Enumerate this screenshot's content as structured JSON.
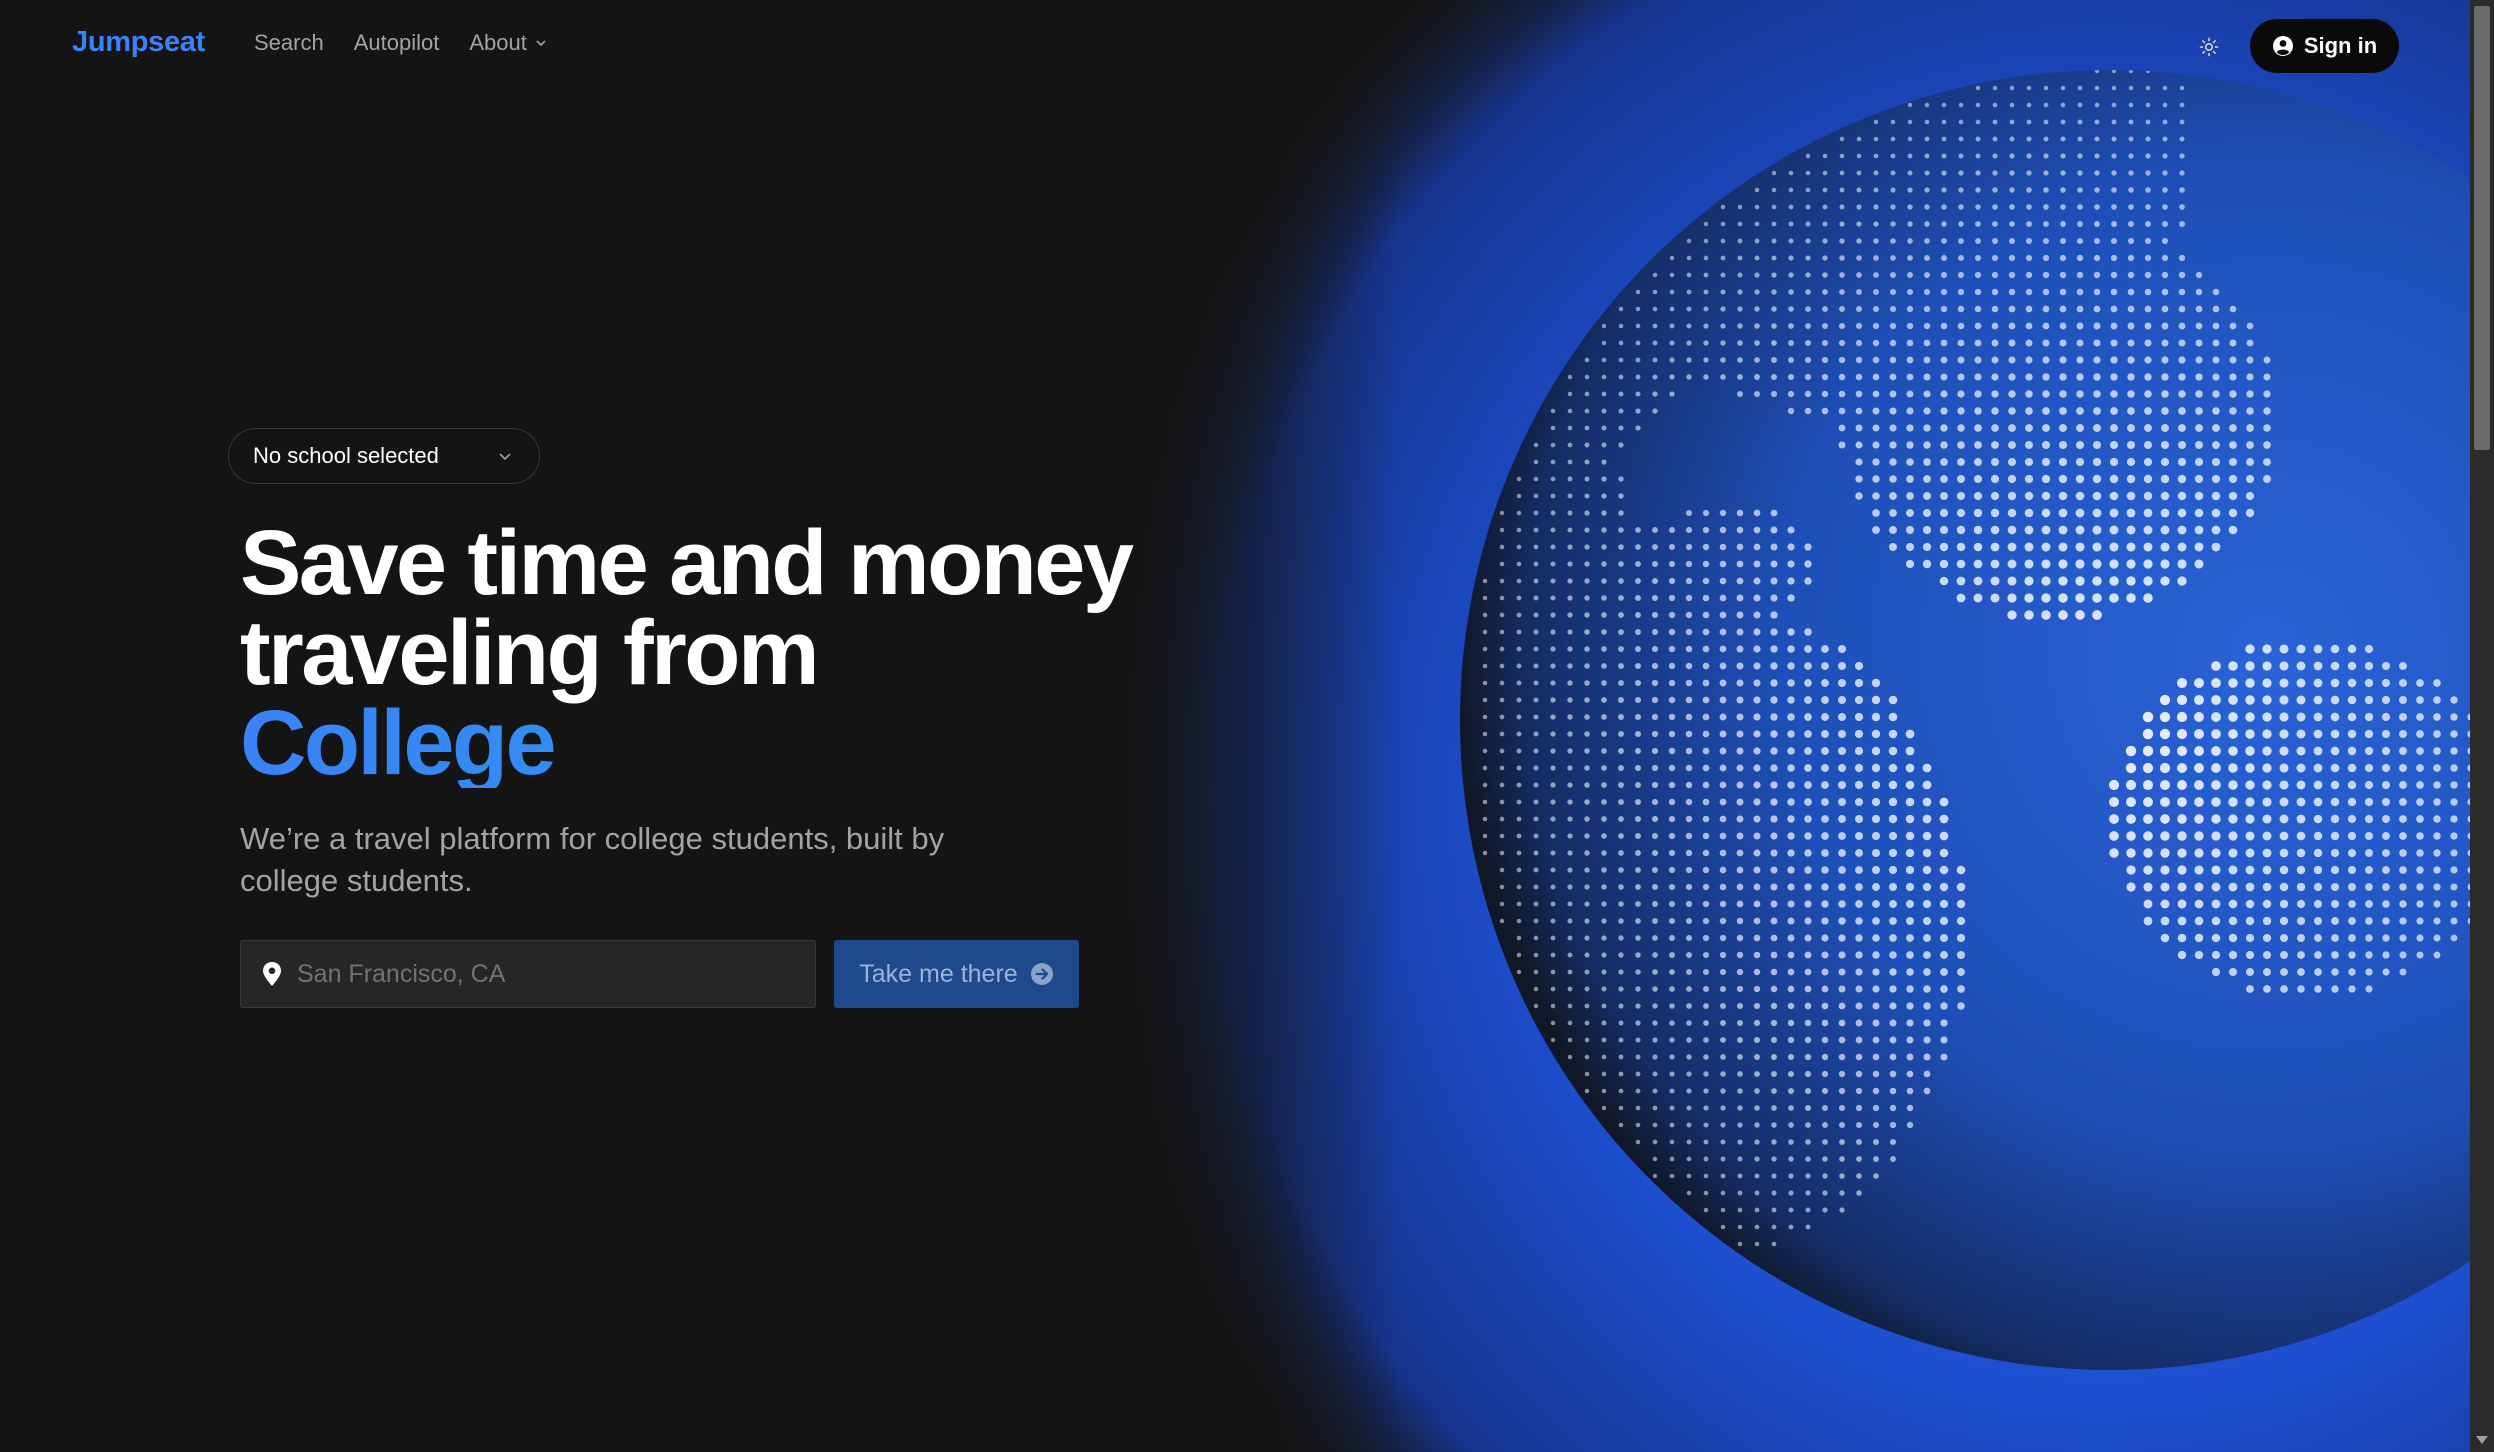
{
  "header": {
    "logo": "Jumpseat",
    "nav": [
      {
        "label": "Search"
      },
      {
        "label": "Autopilot"
      },
      {
        "label": "About",
        "icon": "chevron-down-icon"
      }
    ],
    "theme_toggle_icon": "sun-icon",
    "signin_label": "Sign in",
    "signin_icon": "user-circle-icon"
  },
  "hero": {
    "school_select": "No school selected",
    "headline_line1": "Save time and money",
    "headline_line2": "traveling from",
    "headline_accent": "College",
    "subtext": "We’re a travel platform for college students, built by college students.",
    "search": {
      "placeholder": "San Francisco, CA",
      "value": "",
      "icon": "map-pin-icon"
    },
    "cta_label": "Take me there",
    "cta_icon": "arrow-right-circle-icon"
  },
  "colors": {
    "background": "#141414",
    "accent": "#3b82f6",
    "globe_blue": "#1d4ed8",
    "button_bg": "#1e4a8c"
  },
  "background_image": "dotted-globe"
}
